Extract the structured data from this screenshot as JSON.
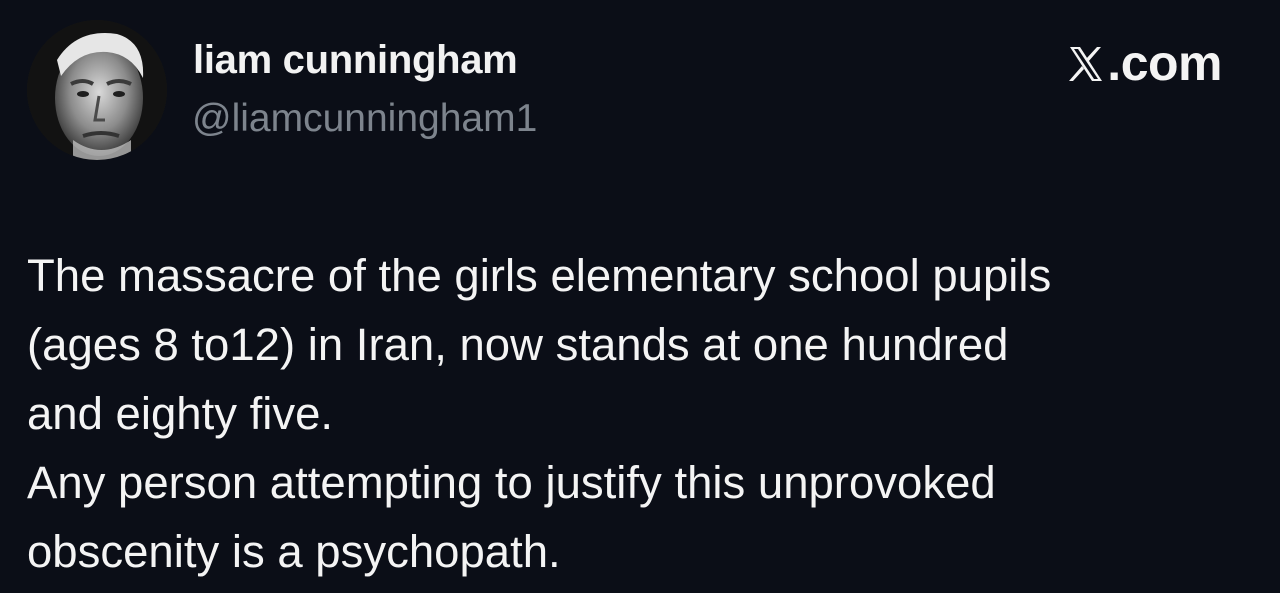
{
  "author": {
    "display_name": "liam cunningham",
    "handle": "@liamcunningham1",
    "avatar_icon": "profile-photo"
  },
  "brand": {
    "label": ".com",
    "icon": "x-logo-icon"
  },
  "tweet": {
    "lines": [
      "The massacre of the girls elementary school pupils",
      "(ages 8 to12) in Iran, now stands at one hundred",
      "and eighty five.",
      "Any person attempting to justify this unprovoked",
      "obscenity is a psychopath."
    ]
  },
  "colors": {
    "background": "#0b0e17",
    "text": "#f4f4f4",
    "handle": "#7d848d"
  }
}
